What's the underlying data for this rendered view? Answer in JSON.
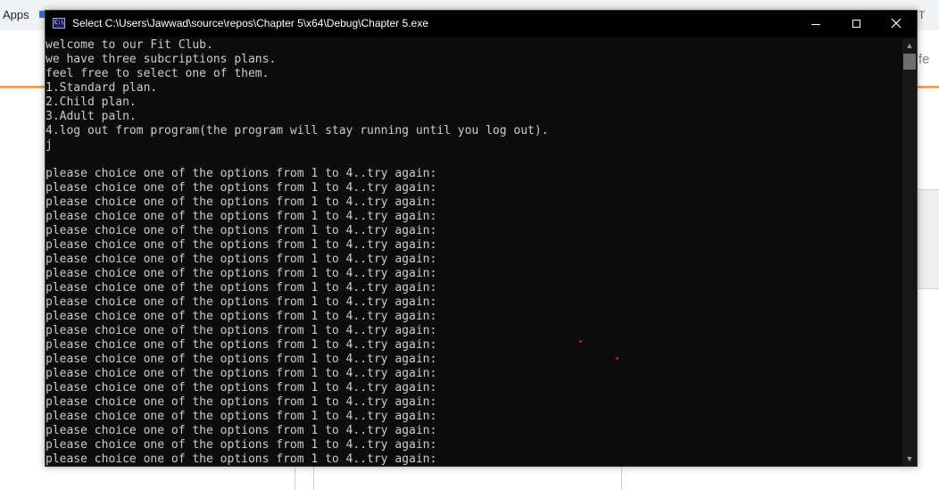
{
  "background": {
    "bookmarks_label": "Apps",
    "right_fragment": "fe",
    "right_top_fragment": "T"
  },
  "window": {
    "title": "Select C:\\Users\\Jawwad\\source\\repos\\Chapter 5\\x64\\Debug\\Chapter 5.exe",
    "icon_text": "C:\\"
  },
  "console": {
    "lines": [
      "welcome to our Fit Club.",
      "we have three subcriptions plans.",
      "feel free to select one of them.",
      "1.Standard plan.",
      "2.Child plan.",
      "3.Adult paln.",
      "4.log out from program(the program will stay running until you log out).",
      "j",
      "",
      "please choice one of the options from 1 to 4..try again:",
      "please choice one of the options from 1 to 4..try again:",
      "please choice one of the options from 1 to 4..try again:",
      "please choice one of the options from 1 to 4..try again:",
      "please choice one of the options from 1 to 4..try again:",
      "please choice one of the options from 1 to 4..try again:",
      "please choice one of the options from 1 to 4..try again:",
      "please choice one of the options from 1 to 4..try again:",
      "please choice one of the options from 1 to 4..try again:",
      "please choice one of the options from 1 to 4..try again:",
      "please choice one of the options from 1 to 4..try again:",
      "please choice one of the options from 1 to 4..try again:",
      "please choice one of the options from 1 to 4..try again:",
      "please choice one of the options from 1 to 4..try again:",
      "please choice one of the options from 1 to 4..try again:",
      "please choice one of the options from 1 to 4..try again:",
      "please choice one of the options from 1 to 4..try again:",
      "please choice one of the options from 1 to 4..try again:",
      "please choice one of the options from 1 to 4..try again:",
      "please choice one of the options from 1 to 4..try again:",
      "please choice one of the options from 1 to 4..try again:"
    ]
  },
  "colors": {
    "console_bg": "#0c0c0c",
    "console_text": "#cccccc",
    "title_bar": "#000000",
    "accent_orange": "#f5a25d"
  },
  "icons": {
    "minimize": "minimize-icon",
    "maximize": "maximize-icon",
    "close": "close-icon",
    "scroll_up": "scroll-up-arrow-icon",
    "scroll_down": "scroll-down-arrow-icon"
  }
}
